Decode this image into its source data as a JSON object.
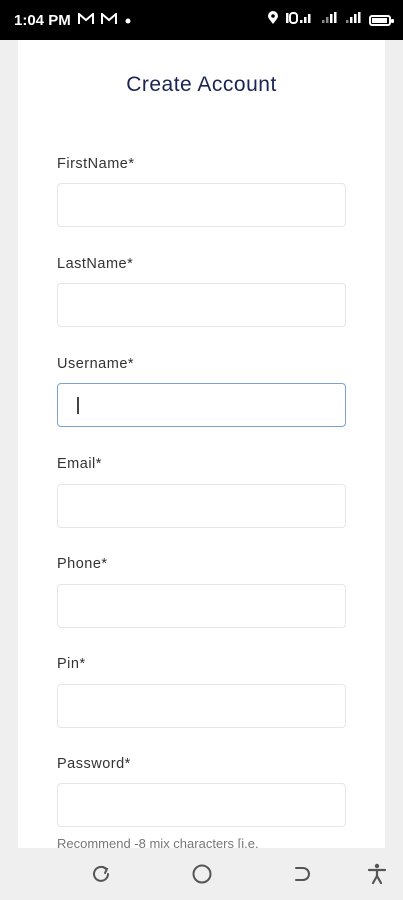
{
  "status_bar": {
    "time": "1:04 PM",
    "left_icons": [
      "gmail-icon",
      "gmail-icon",
      "notification-dot-icon"
    ],
    "right_icons": [
      "location-icon",
      "volte-icon",
      "signal-icon",
      "signal-icon",
      "battery-icon"
    ],
    "battery_level": 0.96
  },
  "form": {
    "title": "Create Account",
    "fields": [
      {
        "label": "FirstName*",
        "value": "",
        "placeholder": ""
      },
      {
        "label": "LastName*",
        "value": "",
        "placeholder": ""
      },
      {
        "label": "Username*",
        "value": "",
        "placeholder": "",
        "focused": true
      },
      {
        "label": "Email*",
        "value": "",
        "placeholder": ""
      },
      {
        "label": "Phone*",
        "value": "",
        "placeholder": ""
      },
      {
        "label": "Pin*",
        "value": "",
        "placeholder": ""
      },
      {
        "label": "Password*",
        "value": "",
        "placeholder": ""
      }
    ],
    "password_hint": "Recommend -8 mix characters [i.e."
  },
  "nav_bar": {
    "icons": [
      "recent-apps-icon",
      "home-icon",
      "back-icon",
      "accessibility-icon"
    ]
  },
  "colors": {
    "title": "#1b2454",
    "focus_border": "#7aa2d6",
    "background": "#efefef"
  }
}
